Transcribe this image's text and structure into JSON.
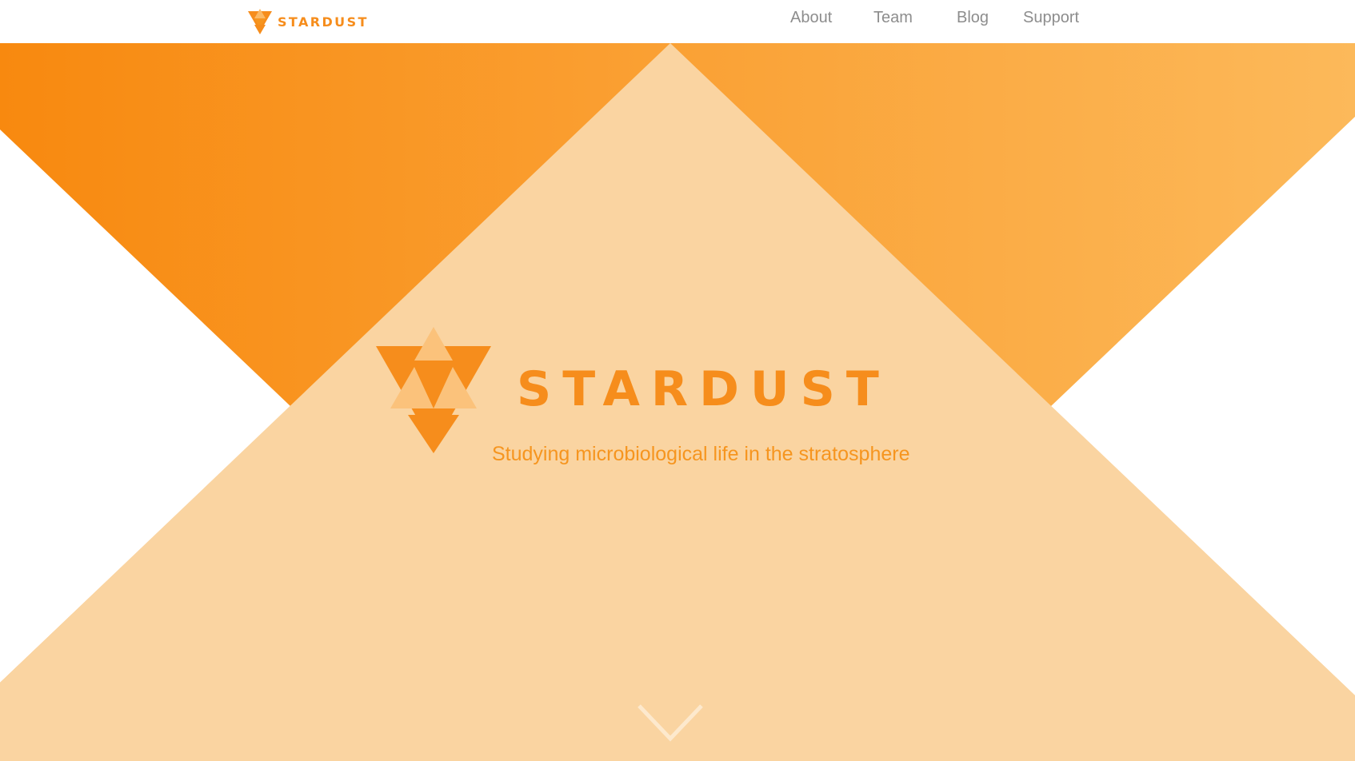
{
  "nav": {
    "brand": "STARDUST",
    "links": [
      "About",
      "Team",
      "Blog",
      "Support"
    ]
  },
  "hero": {
    "title": "STARDUST",
    "tagline": "Studying microbiological life in the stratosphere"
  },
  "colors": {
    "brand_orange": "#f68d1c",
    "peach": "#fad4a1",
    "gradient_start": "#f8890f",
    "gradient_end": "#fcb95a",
    "nav_text": "#8d8d8d"
  },
  "icons": {
    "brand_logo": "triangle-star-logo-icon",
    "scroll": "chevron-down-icon"
  }
}
